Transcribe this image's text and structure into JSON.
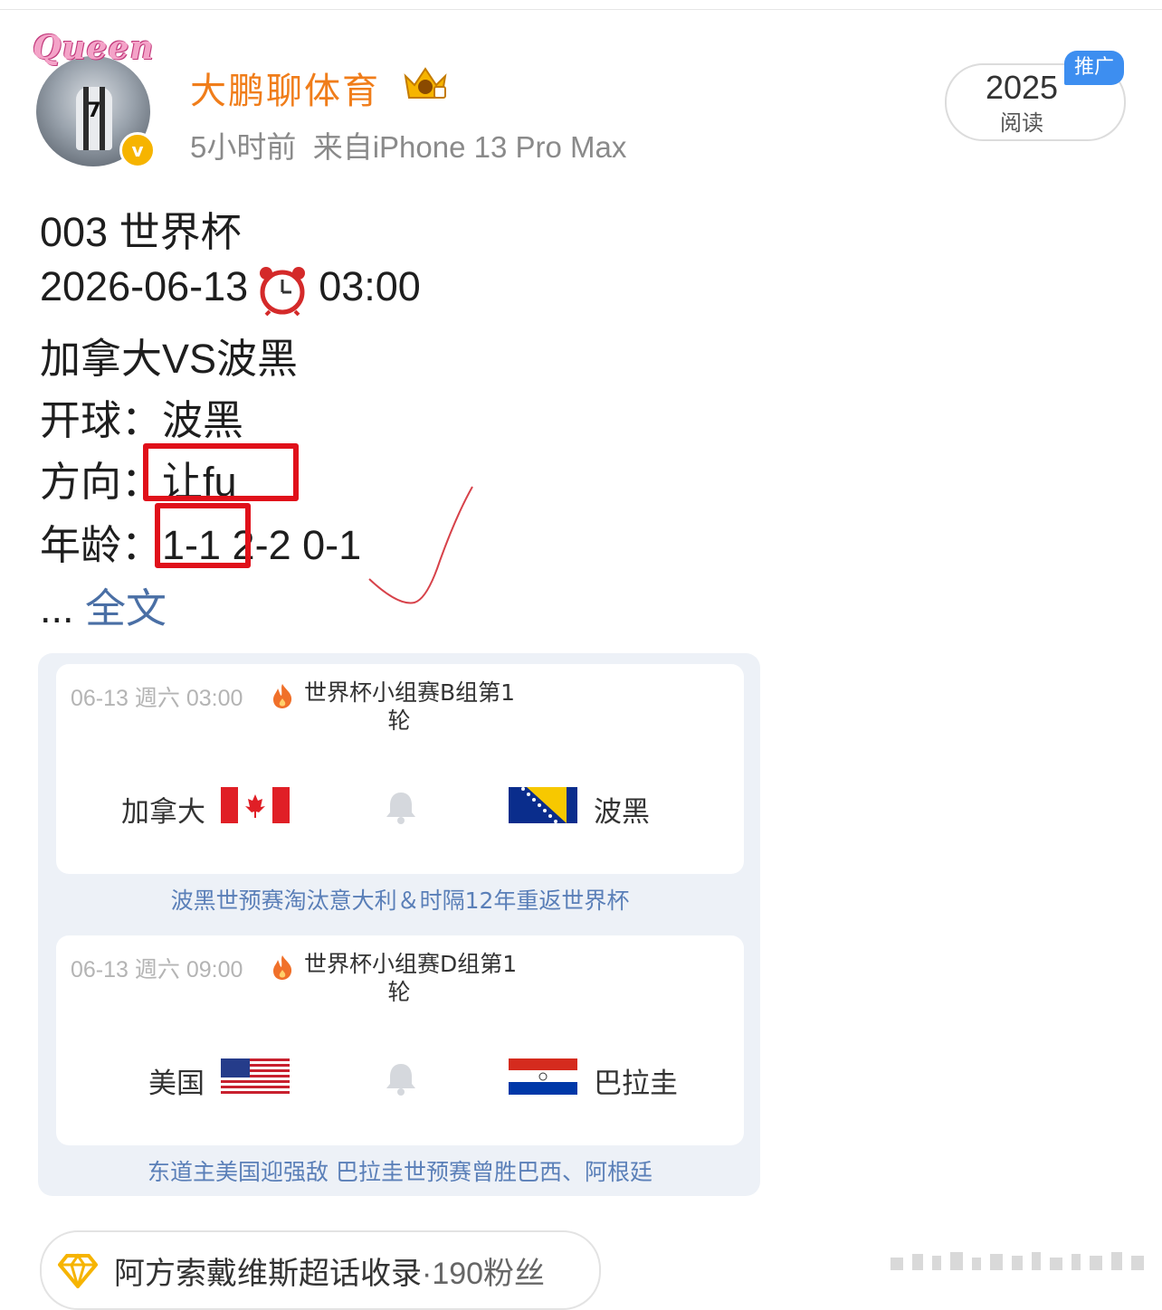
{
  "header": {
    "avatar_text": "Queen",
    "username": "大鹏聊体育",
    "time": "5小时前",
    "source": "来自iPhone 13 Pro Max",
    "reads_count": "2025",
    "reads_label": "阅读",
    "promo_tag": "推广"
  },
  "post": {
    "line1": "003 世界杯",
    "line2_date": "2026-06-13",
    "line2_time": "03:00",
    "line3": "加拿大VS波黑",
    "line4_label": "开球：",
    "line4_value": "波黑",
    "line5_label": "方向：",
    "line5_value": "让fu",
    "line6_label": "年龄：",
    "line6_value": "1-1 2-2 0-1",
    "ellipsis": "...",
    "full_text_link": "全文"
  },
  "matches": [
    {
      "time": "06-13 週六 03:00",
      "league_line1": "世界杯小组赛B组第1",
      "league_line2": "轮",
      "home": "加拿大",
      "away": "波黑",
      "note": "波黑世预赛淘汰意大利＆时隔12年重返世界杯"
    },
    {
      "time": "06-13 週六 09:00",
      "league_line1": "世界杯小组赛D组第1",
      "league_line2": "轮",
      "home": "美国",
      "away": "巴拉圭",
      "note": "东道主美国迎强敌 巴拉圭世预赛曾胜巴西、阿根廷"
    }
  ],
  "topic": {
    "name": "阿方索戴维斯超话收录",
    "separator": "·",
    "fans": "190粉丝"
  },
  "colors": {
    "username": "#f07d1a",
    "link": "#4a6fa5",
    "highlight_box": "#e0101a",
    "promo": "#3d8ef0"
  }
}
